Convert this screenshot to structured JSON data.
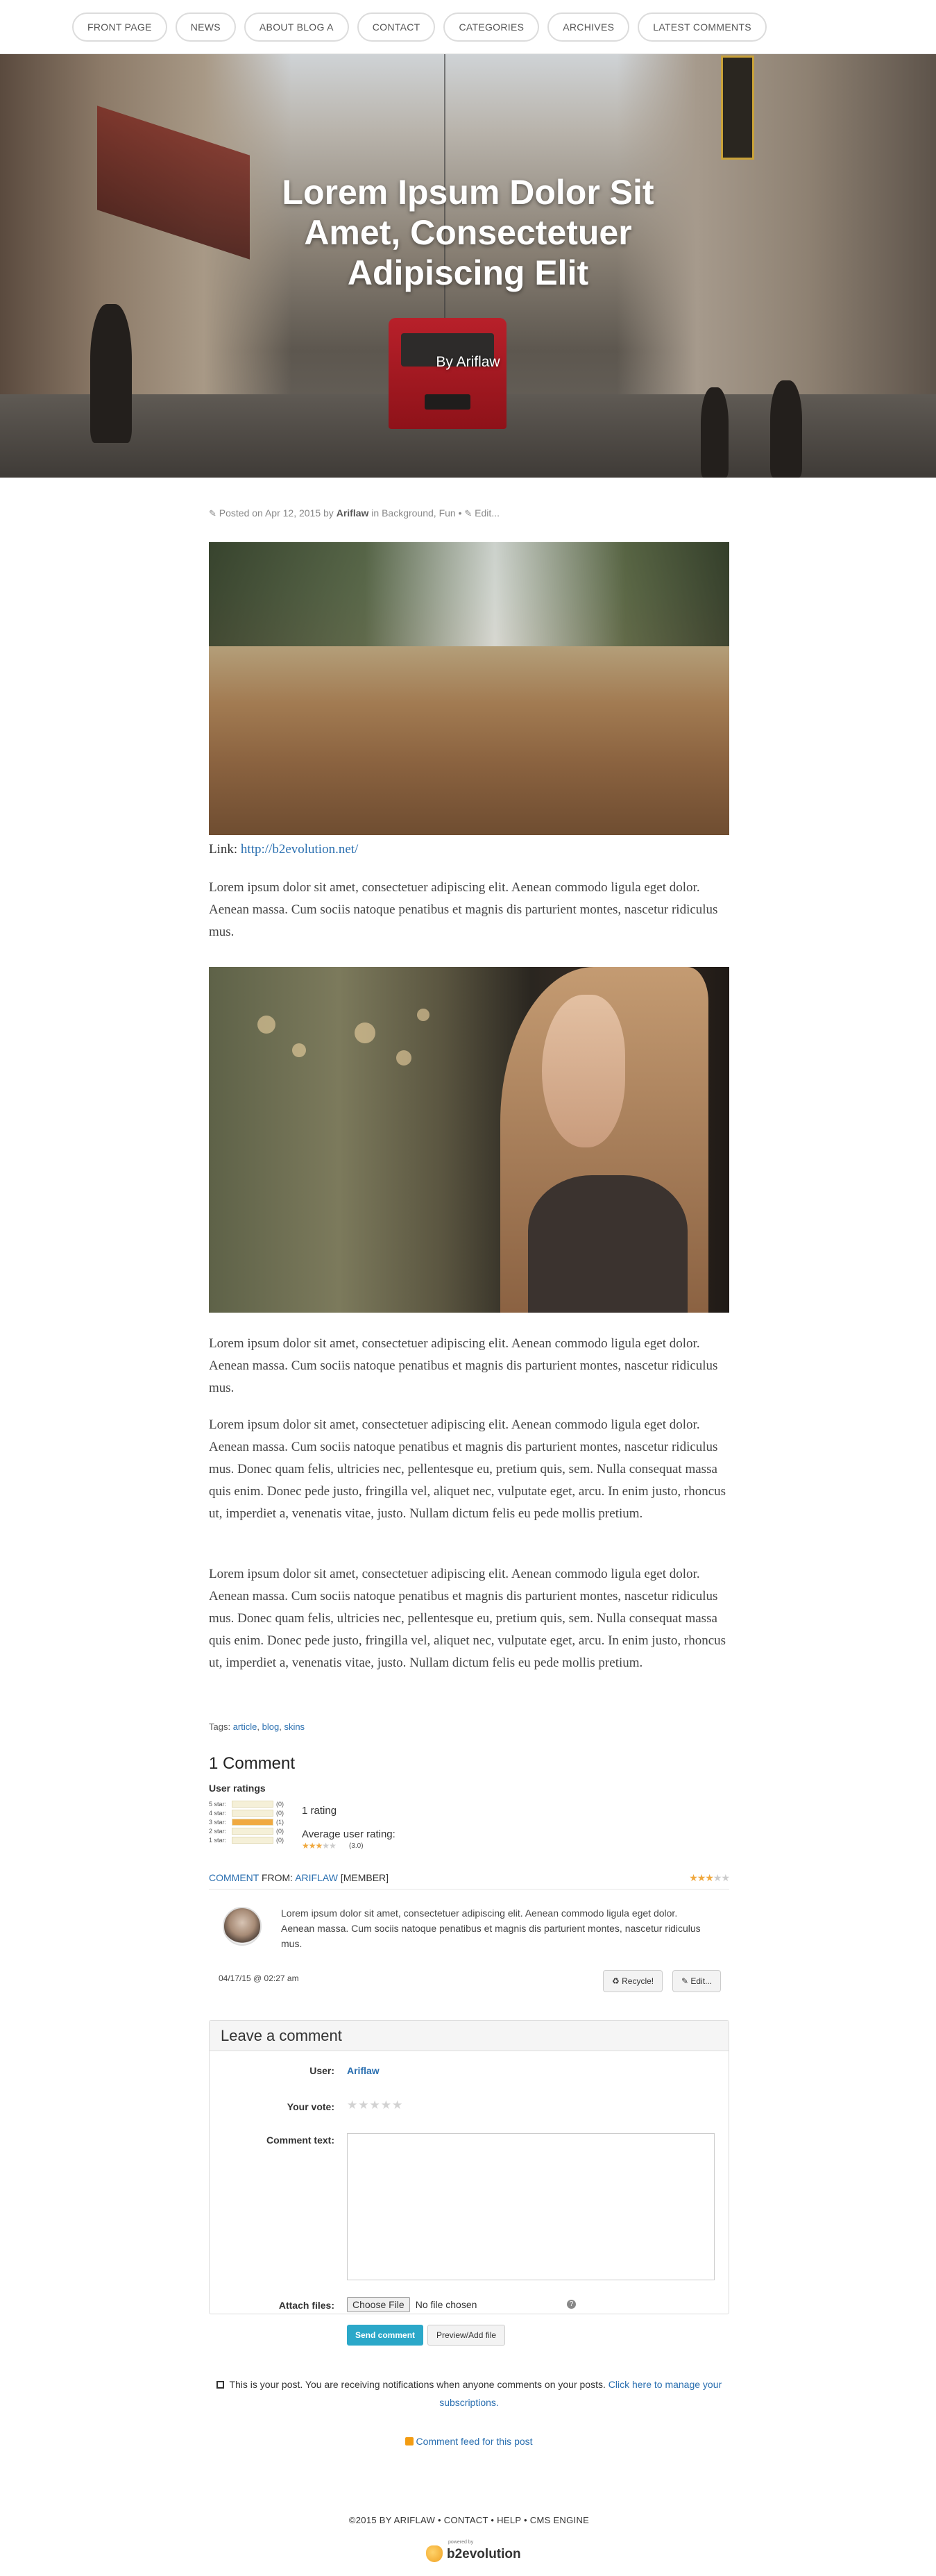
{
  "nav": {
    "items": [
      "FRONT PAGE",
      "NEWS",
      "ABOUT BLOG A",
      "CONTACT",
      "CATEGORIES",
      "ARCHIVES",
      "LATEST COMMENTS"
    ]
  },
  "hero": {
    "title": "Lorem Ipsum Dolor Sit Amet, Consectetuer Adipiscing Elit",
    "byline": "By Ariflaw"
  },
  "post_meta": {
    "posted_on": "Posted on Apr 12, 2015 by",
    "author": "Ariflaw",
    "categories": "in Background, Fun •",
    "edit": "Edit..."
  },
  "link": {
    "label": "Link:",
    "url_text": "http://b2evolution.net/"
  },
  "paragraphs": {
    "p1": "Lorem ipsum dolor sit amet, consectetuer adipiscing elit. Aenean commodo ligula eget dolor. Aenean massa. Cum sociis natoque penatibus et magnis dis parturient montes, nascetur ridiculus mus.",
    "p2": "Lorem ipsum dolor sit amet, consectetuer adipiscing elit. Aenean commodo ligula eget dolor. Aenean massa. Cum sociis natoque penatibus et magnis dis parturient montes, nascetur ridiculus mus.",
    "p3": "Lorem ipsum dolor sit amet, consectetuer adipiscing elit. Aenean commodo ligula eget dolor. Aenean massa. Cum sociis natoque penatibus et magnis dis parturient montes, nascetur ridiculus mus. Donec quam felis, ultricies nec, pellentesque eu, pretium quis, sem. Nulla consequat massa quis enim. Donec pede justo, fringilla vel, aliquet nec, vulputate eget, arcu. In enim justo, rhoncus ut, imperdiet a, venenatis vitae, justo. Nullam dictum felis eu pede mollis pretium.",
    "p4": "Lorem ipsum dolor sit amet, consectetuer adipiscing elit. Aenean commodo ligula eget dolor. Aenean massa. Cum sociis natoque penatibus et magnis dis parturient montes, nascetur ridiculus mus. Donec quam felis, ultricies nec, pellentesque eu, pretium quis, sem. Nulla consequat massa quis enim. Donec pede justo, fringilla vel, aliquet nec, vulputate eget, arcu. In enim justo, rhoncus ut, imperdiet a, venenatis vitae, justo. Nullam dictum felis eu pede mollis pretium."
  },
  "tags": {
    "label": "Tags:",
    "items": [
      "article",
      "blog",
      "skins"
    ]
  },
  "comments": {
    "heading": "1 Comment",
    "user_ratings_title": "User ratings",
    "rating_rows": [
      {
        "label": "5 star:",
        "count": "(0)",
        "fraction": 0
      },
      {
        "label": "4 star:",
        "count": "(0)",
        "fraction": 0
      },
      {
        "label": "3 star:",
        "count": "(1)",
        "fraction": 1
      },
      {
        "label": "2 star:",
        "count": "(0)",
        "fraction": 0
      },
      {
        "label": "1 star:",
        "count": "(0)",
        "fraction": 0
      }
    ],
    "rating_count": "1 rating",
    "average_label": "Average user rating:",
    "average_value": "(3.0)",
    "average_stars": 3,
    "comment": {
      "kind": "COMMENT",
      "from_label": "FROM:",
      "author": "ARIFLAW",
      "role": "[MEMBER]",
      "stars": 3,
      "text": "Lorem ipsum dolor sit amet, consectetuer adipiscing elit. Aenean commodo ligula eget dolor. Aenean massa. Cum sociis natoque penatibus et magnis dis parturient montes, nascetur ridiculus mus.",
      "date": "04/17/15 @ 02:27 am",
      "recycle_label": "Recycle!",
      "edit_label": "Edit..."
    }
  },
  "form": {
    "title": "Leave a comment",
    "user_label": "User:",
    "user_value": "Ariflaw",
    "vote_label": "Your vote:",
    "comment_text_label": "Comment text:",
    "attach_label": "Attach files:",
    "choose_file": "Choose File",
    "no_file": "No file chosen",
    "help": "?",
    "send_label": "Send comment",
    "preview_label": "Preview/Add file"
  },
  "notify": {
    "text": "This is your post. You are receiving notifications when anyone comments on your posts.",
    "link": "Click here to manage your subscriptions."
  },
  "feed": {
    "label": "Comment feed for this post"
  },
  "footer": {
    "text": "©2015 BY ARIFLAW • CONTACT • HELP • CMS ENGINE",
    "powered": "powered by",
    "logo_text": "b2evolution"
  },
  "colors": {
    "link": "#2a6fb0",
    "accent_button": "#2ba8c9",
    "star": "#f0a940"
  }
}
